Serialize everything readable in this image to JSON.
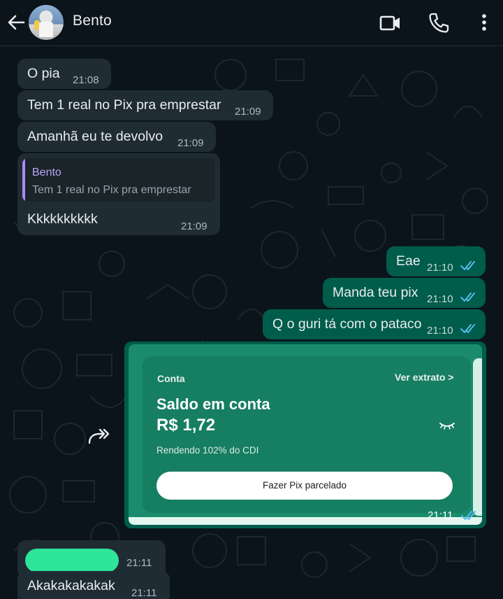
{
  "header": {
    "contact_name": "Bento",
    "back_icon": "arrow-left-icon",
    "avatar": "contact-avatar",
    "video_icon": "video-call-icon",
    "phone_icon": "voice-call-icon",
    "more_icon": "more-vertical-icon"
  },
  "messages": {
    "m1": {
      "text": "O pia",
      "time": "21:08"
    },
    "m2": {
      "text": "Tem 1 real no Pix pra emprestar",
      "time": "21:09"
    },
    "m3": {
      "text": "Amanhã eu te devolvo",
      "time": "21:09"
    },
    "m4": {
      "quote_name": "Bento",
      "quote_text": "Tem 1 real no Pix pra emprestar",
      "text": "Kkkkkkkkkk",
      "time": "21:09"
    },
    "m5": {
      "text": "Eae",
      "time": "21:10",
      "status": "read"
    },
    "m6": {
      "text": "Manda teu pix",
      "time": "21:10",
      "status": "read"
    },
    "m7": {
      "text": "Q o guri tá com o pataco",
      "time": "21:10",
      "status": "read"
    },
    "m8": {
      "time": "21:11",
      "status": "read",
      "card": {
        "title": "Conta",
        "link": "Ver extrato >",
        "heading": "Saldo em conta",
        "amount": "R$ 1,72",
        "subtitle": "Rendendo 102% do CDI",
        "button": "Fazer Pix parcelado"
      }
    },
    "m9": {
      "time": "21:11",
      "redacted": true
    },
    "m10": {
      "text": "Akakakakakak",
      "time": "21:11"
    }
  },
  "colors": {
    "background": "#0b141a",
    "incoming_bubble": "#202c33",
    "outgoing_bubble": "#005c4b",
    "read_ticks": "#53bdeb",
    "quote_accent": "#a78bfa",
    "card_green": "#167e61",
    "redaction": "#2ee59a"
  }
}
